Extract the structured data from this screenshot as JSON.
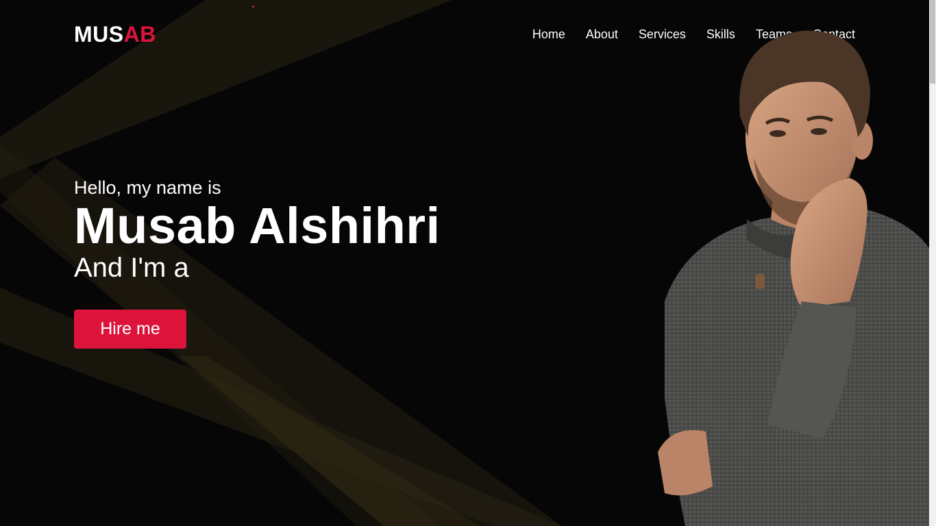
{
  "header": {
    "logo_part1": "MUS",
    "logo_part2": "AB",
    "nav": [
      "Home",
      "About",
      "Services",
      "Skills",
      "Teams",
      "Contact"
    ]
  },
  "hero": {
    "greeting": "Hello, my name is",
    "name": "Musab Alshihri",
    "role_prefix": "And I'm a",
    "cta_label": "Hire me"
  },
  "colors": {
    "accent": "#dc143c",
    "background": "#060606",
    "text": "#ffffff"
  }
}
